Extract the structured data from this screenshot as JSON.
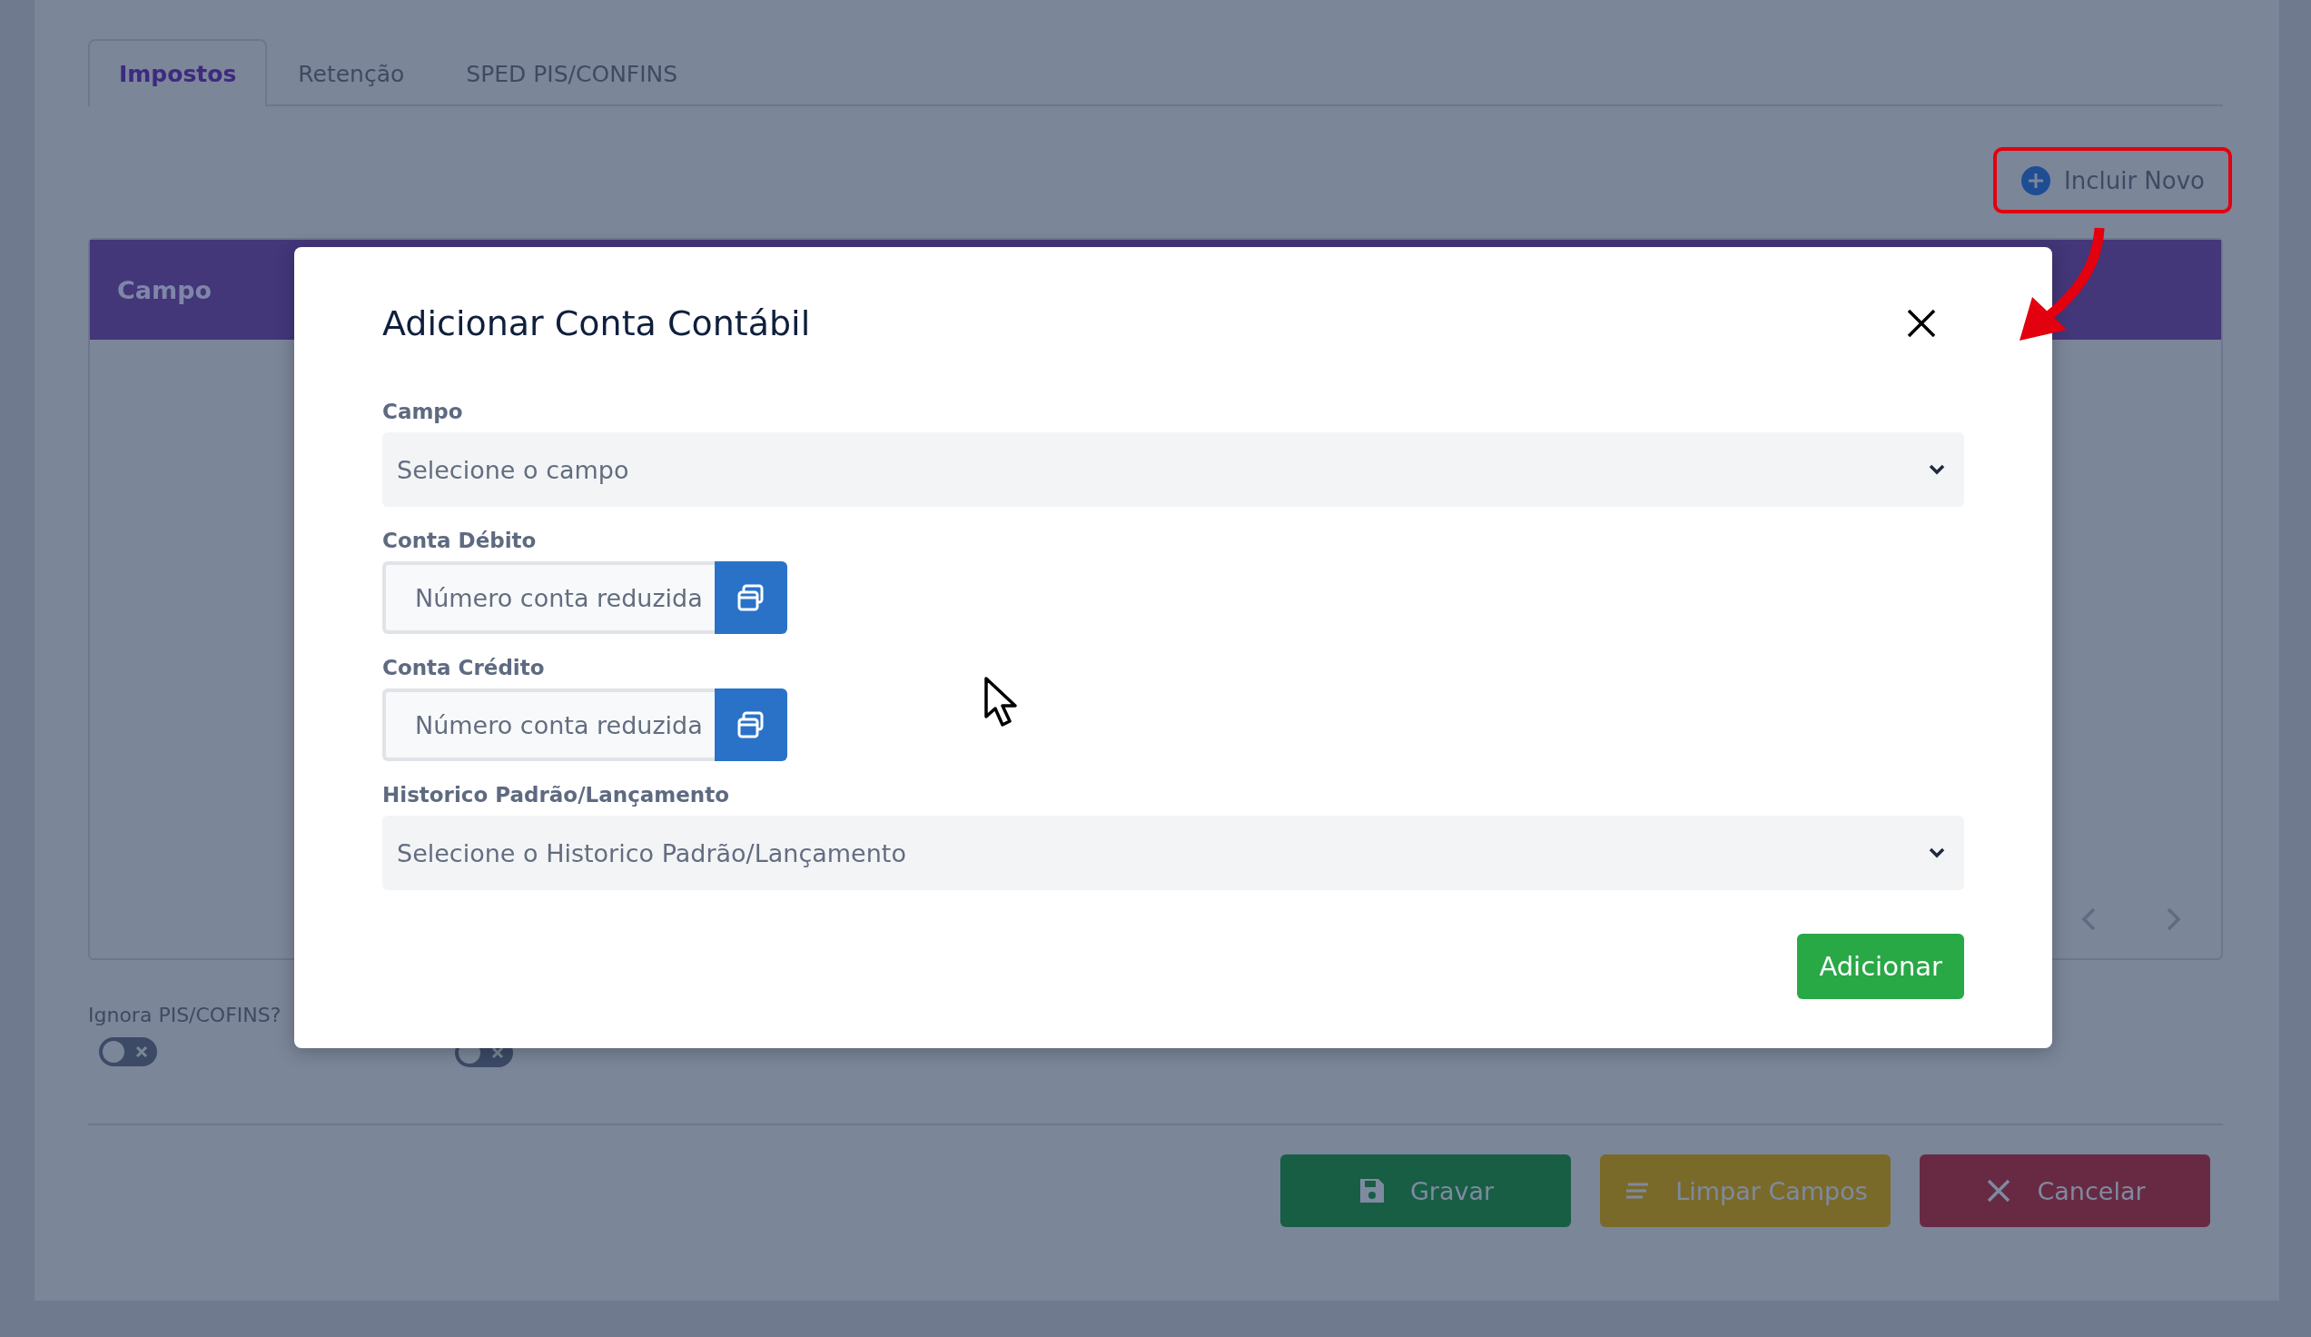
{
  "tabs": [
    {
      "label": "Impostos",
      "selected": true
    },
    {
      "label": "Retenção",
      "selected": false
    },
    {
      "label": "SPED PIS/CONFINS",
      "selected": false
    }
  ],
  "add_button": {
    "label": "Incluir Novo",
    "highlighted": true
  },
  "table": {
    "columns": [
      "Campo"
    ]
  },
  "toggles": [
    {
      "label": "Ignora PIS/COFINS?",
      "on": false
    },
    {
      "on": false
    }
  ],
  "actions": [
    {
      "label": "Gravar",
      "kind": "save"
    },
    {
      "label": "Limpar Campos",
      "kind": "clear"
    },
    {
      "label": "Cancelar",
      "kind": "cancel"
    }
  ],
  "dialog": {
    "title": "Adicionar Conta Contábil",
    "fields": [
      {
        "kind": "select",
        "label": "Campo",
        "placeholder": "Selecione o campo"
      },
      {
        "kind": "lookup",
        "label": "Conta Débito",
        "placeholder": "Número conta reduzida"
      },
      {
        "kind": "lookup",
        "label": "Conta Crédito",
        "placeholder": "Número conta reduzida"
      },
      {
        "kind": "select",
        "label": "Historico Padrão/Lançamento",
        "placeholder": "Selecione o Historico Padrão/Lançamento"
      }
    ],
    "submit": "Adicionar"
  }
}
